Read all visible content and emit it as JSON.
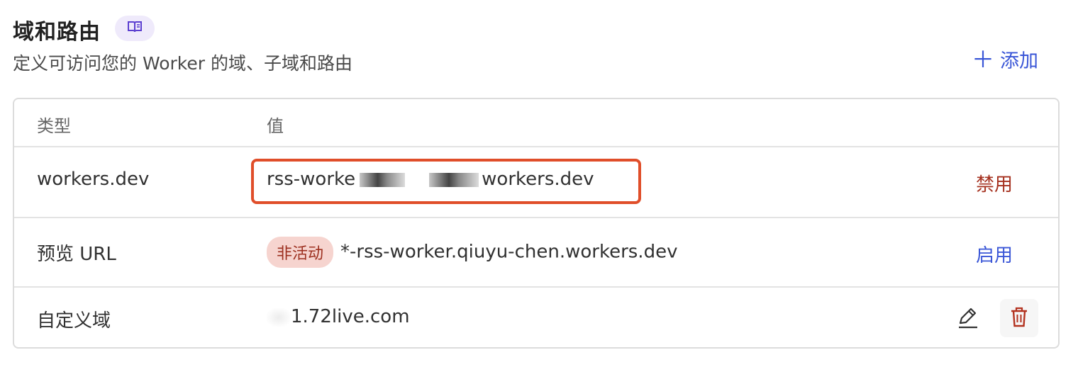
{
  "section": {
    "title": "域和路由",
    "subtitle": "定义可访问您的 Worker 的域、子域和路由",
    "add_label": "添加",
    "docs_icon": "book-icon"
  },
  "table": {
    "headers": {
      "type": "类型",
      "value": "值"
    },
    "rows": [
      {
        "type": "workers.dev",
        "value_prefix": "rss-worke",
        "value_suffix": "workers.dev",
        "action": "禁用"
      },
      {
        "type": "预览 URL",
        "status": "非活动",
        "value": "*-rss-worker.qiuyu-chen.workers.dev",
        "action": "启用"
      },
      {
        "type": "自定义域",
        "value": "1.72live.com",
        "icons": [
          "edit-icon",
          "trash-icon"
        ]
      }
    ]
  },
  "colors": {
    "accent_blue": "#3a56d7",
    "danger_red": "#a5301e",
    "highlight_border": "#e04e2a",
    "pill_bg": "#f6d4cf"
  }
}
